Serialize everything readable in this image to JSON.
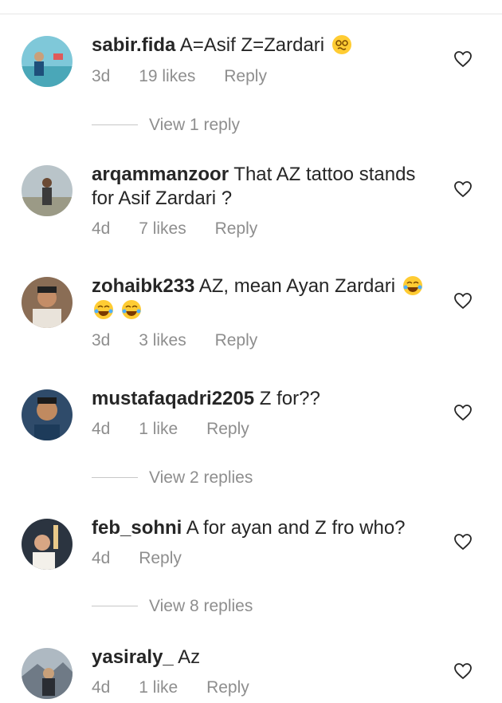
{
  "comments": [
    {
      "username": "sabir.fida",
      "text": "A=Asif Z=Zardari",
      "age": "3d",
      "likes": "19 likes",
      "reply": "Reply",
      "emoji": [
        "woozy-face-icon"
      ]
    },
    {
      "username": "arqammanzoor",
      "text": "That AZ tattoo stands for Asif Zardari ?",
      "age": "4d",
      "likes": "7 likes",
      "reply": "Reply",
      "emoji": []
    },
    {
      "username": "zohaibk233",
      "text": "AZ, mean Ayan Zardari",
      "age": "3d",
      "likes": "3 likes",
      "reply": "Reply",
      "emoji": [
        "tears-of-joy-icon",
        "tears-of-joy-icon",
        "tears-of-joy-icon"
      ]
    },
    {
      "username": "mustafaqadri2205",
      "text": "Z for??",
      "age": "4d",
      "likes": "1 like",
      "reply": "Reply",
      "emoji": []
    },
    {
      "username": "feb_sohni",
      "text": "A for ayan and Z fro who?",
      "age": "4d",
      "likes": "",
      "reply": "Reply",
      "emoji": []
    },
    {
      "username": "yasiraly_",
      "text": "Az",
      "age": "4d",
      "likes": "1 like",
      "reply": "Reply",
      "emoji": []
    }
  ],
  "view_replies": [
    "View 1 reply",
    "View 2 replies",
    "View 8 replies"
  ],
  "icons": {
    "like": "heart-outline-icon"
  },
  "colors": {
    "text": "#262626",
    "secondary": "#8e8e8e",
    "divider": "#c7c7c7"
  }
}
